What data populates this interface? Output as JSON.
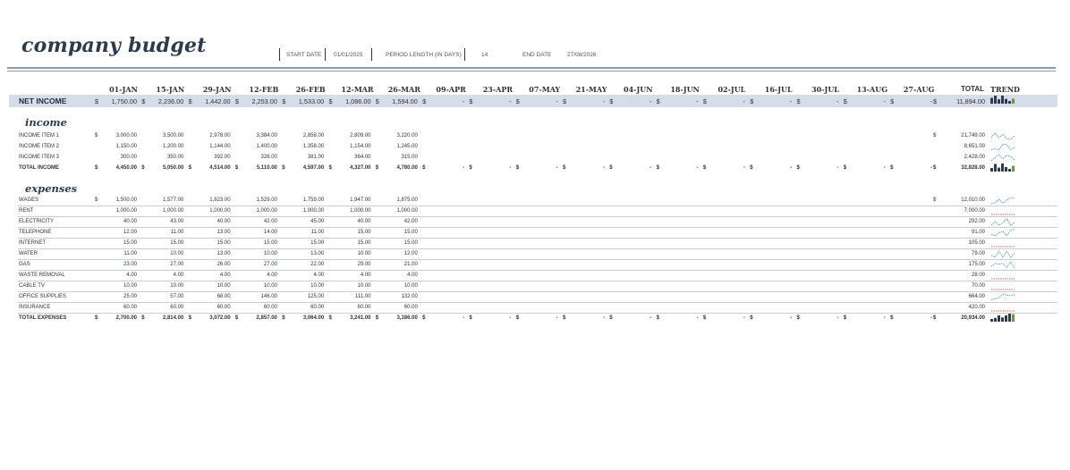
{
  "title": "company budget",
  "meta": {
    "start_date_label": "START DATE",
    "start_date": "01/01/2025",
    "period_length_label": "PERIOD LENGTH (IN DAYS)",
    "period_length": "14",
    "end_date_label": "END DATE",
    "end_date": "27/08/2026"
  },
  "columns": [
    "01-JAN",
    "15-JAN",
    "29-JAN",
    "12-FEB",
    "26-FEB",
    "12-MAR",
    "26-MAR",
    "09-APR",
    "23-APR",
    "07-MAY",
    "21-MAY",
    "04-JUN",
    "18-JUN",
    "02-JUL",
    "16-JUL",
    "30-JUL",
    "13-AUG",
    "27-AUG"
  ],
  "total_label": "TOTAL",
  "trend_label": "TREND",
  "currency": "$",
  "empty_value": "-",
  "net_income": {
    "label": "NET INCOME",
    "values": [
      "1,750.00",
      "2,236.00",
      "1,442.00",
      "2,253.00",
      "1,533.00",
      "1,086.00",
      "1,594.00",
      "",
      "",
      "",
      "",
      "",
      "",
      "",
      "",
      "",
      "",
      ""
    ],
    "total": "11,894.00"
  },
  "income": {
    "heading": "income",
    "rows": [
      {
        "label": "INCOME ITEM 1",
        "currency": true,
        "values": [
          "3,000.00",
          "3,500.00",
          "2,978.00",
          "3,384.00",
          "2,858.00",
          "2,809.00",
          "3,220.00"
        ],
        "total": "21,749.00",
        "total_currency": true
      },
      {
        "label": "INCOME ITEM 2",
        "currency": false,
        "values": [
          "1,150.00",
          "1,200.00",
          "1,144.00",
          "1,400.00",
          "1,358.00",
          "1,154.00",
          "1,245.00"
        ],
        "total": "8,651.00",
        "total_currency": false
      },
      {
        "label": "INCOME ITEM 3",
        "currency": false,
        "values": [
          "300.00",
          "350.00",
          "392.00",
          "326.00",
          "381.00",
          "364.00",
          "315.00"
        ],
        "total": "2,428.00",
        "total_currency": false
      }
    ],
    "total_row": {
      "label": "TOTAL INCOME",
      "values": [
        "4,450.00",
        "5,050.00",
        "4,514.00",
        "5,110.00",
        "4,597.00",
        "4,327.00",
        "4,780.00"
      ],
      "total": "32,828.00"
    }
  },
  "expenses": {
    "heading": "expenses",
    "rows": [
      {
        "label": "WAGES",
        "currency": true,
        "values": [
          "1,500.00",
          "1,577.00",
          "1,823.00",
          "1,529.00",
          "1,759.00",
          "1,947.00",
          "1,875.00"
        ],
        "total": "12,010.00",
        "total_currency": true
      },
      {
        "label": "RENT",
        "currency": false,
        "values": [
          "1,000.00",
          "1,000.00",
          "1,000.00",
          "1,000.00",
          "1,000.00",
          "1,000.00",
          "1,000.00"
        ],
        "total": "7,000.00",
        "total_currency": false
      },
      {
        "label": "ELECTRICITY",
        "currency": false,
        "values": [
          "40.00",
          "43.00",
          "40.00",
          "42.00",
          "45.00",
          "40.00",
          "42.00"
        ],
        "total": "292.00",
        "total_currency": false
      },
      {
        "label": "TELEPHONE",
        "currency": false,
        "values": [
          "12.00",
          "11.00",
          "13.00",
          "14.00",
          "11.00",
          "15.00",
          "15.00"
        ],
        "total": "91.00",
        "total_currency": false
      },
      {
        "label": "INTERNET",
        "currency": false,
        "values": [
          "15.00",
          "15.00",
          "15.00",
          "15.00",
          "15.00",
          "15.00",
          "15.00"
        ],
        "total": "105.00",
        "total_currency": false
      },
      {
        "label": "WATER",
        "currency": false,
        "values": [
          "11.00",
          "10.00",
          "13.00",
          "10.00",
          "13.00",
          "10.00",
          "12.00"
        ],
        "total": "79.00",
        "total_currency": false
      },
      {
        "label": "GAS",
        "currency": false,
        "values": [
          "23.00",
          "27.00",
          "26.00",
          "27.00",
          "22.00",
          "29.00",
          "21.00"
        ],
        "total": "175.00",
        "total_currency": false
      },
      {
        "label": "WASTE REMOVAL",
        "currency": false,
        "values": [
          "4.00",
          "4.00",
          "4.00",
          "4.00",
          "4.00",
          "4.00",
          "4.00"
        ],
        "total": "28.00",
        "total_currency": false
      },
      {
        "label": "CABLE TV",
        "currency": false,
        "values": [
          "10.00",
          "10.00",
          "10.00",
          "10.00",
          "10.00",
          "10.00",
          "10.00"
        ],
        "total": "70.00",
        "total_currency": false
      },
      {
        "label": "OFFICE SUPPLIES",
        "currency": false,
        "values": [
          "25.00",
          "57.00",
          "68.00",
          "146.00",
          "125.00",
          "111.00",
          "132.00"
        ],
        "total": "664.00",
        "total_currency": false
      },
      {
        "label": "INSURANCE",
        "currency": false,
        "values": [
          "60.00",
          "60.00",
          "60.00",
          "60.00",
          "60.00",
          "60.00",
          "60.00"
        ],
        "total": "420.00",
        "total_currency": false
      }
    ],
    "total_row": {
      "label": "TOTAL EXPENSES",
      "values": [
        "2,700.00",
        "2,814.00",
        "3,072.00",
        "2,857.00",
        "3,064.00",
        "3,241.00",
        "3,186.00"
      ],
      "total": "20,934.00"
    }
  },
  "colors": {
    "title": "#2e3b4c",
    "net_band": "#d6dde8",
    "spark_line": "#3a8f8f",
    "spark_low": "#c0392b",
    "bar_dark": "#2e3b4c",
    "bar_light": "#6a9a3a"
  }
}
